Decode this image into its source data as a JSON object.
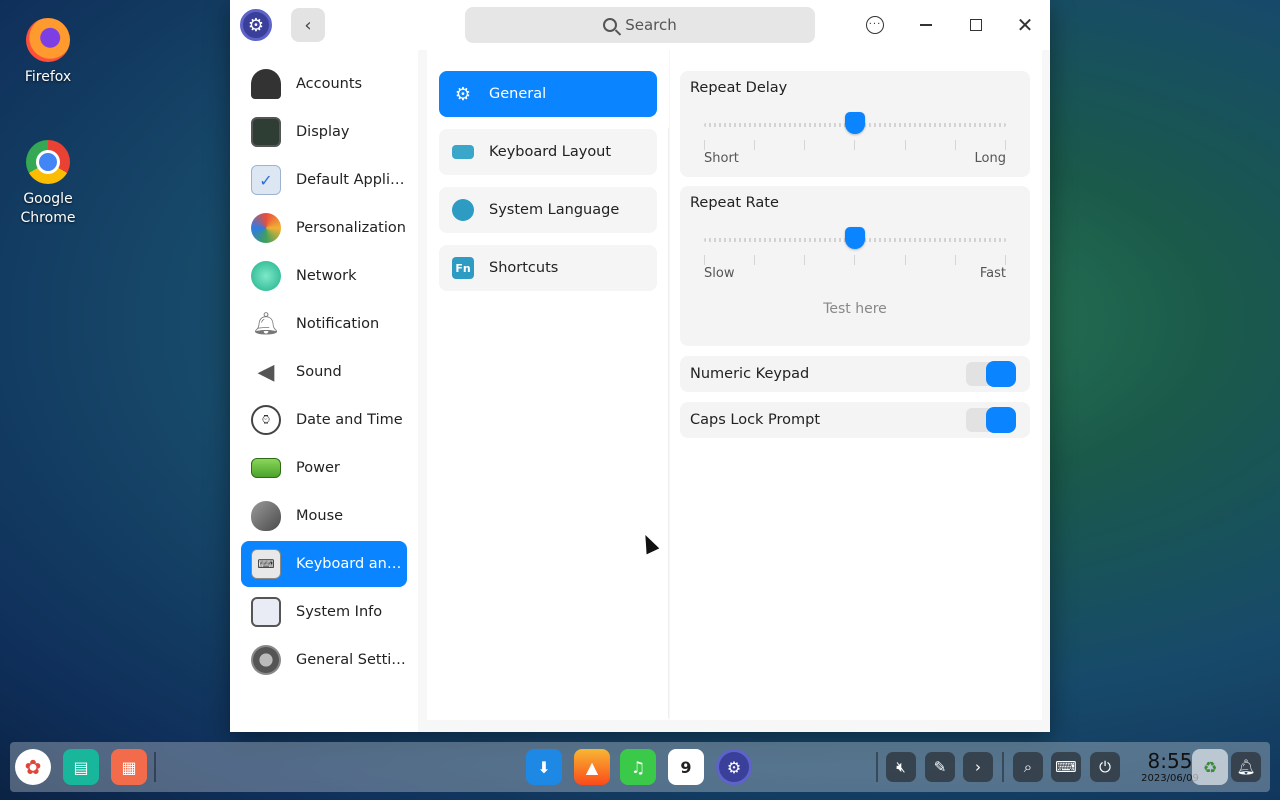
{
  "desktop": {
    "icons": [
      {
        "label": "Firefox",
        "icon": "firefox-icon"
      },
      {
        "label": "Google\nChrome",
        "icon": "chrome-icon"
      }
    ]
  },
  "window": {
    "search_placeholder": "Search",
    "left_nav": [
      {
        "label": "Accounts",
        "icon": "accounts-icon"
      },
      {
        "label": "Display",
        "icon": "display-icon"
      },
      {
        "label": "Default Applic...",
        "icon": "default-applications-icon"
      },
      {
        "label": "Personalization",
        "icon": "personalization-icon"
      },
      {
        "label": "Network",
        "icon": "network-icon"
      },
      {
        "label": "Notification",
        "icon": "notification-icon"
      },
      {
        "label": "Sound",
        "icon": "sound-icon"
      },
      {
        "label": "Date and Time",
        "icon": "clock-icon"
      },
      {
        "label": "Power",
        "icon": "battery-icon"
      },
      {
        "label": "Mouse",
        "icon": "mouse-icon"
      },
      {
        "label": "Keyboard and ...",
        "icon": "keyboard-icon",
        "active": true
      },
      {
        "label": "System Info",
        "icon": "system-info-icon"
      },
      {
        "label": "General Settin...",
        "icon": "general-settings-icon"
      }
    ],
    "sub_nav": [
      {
        "label": "General",
        "icon": "gear-icon",
        "active": true
      },
      {
        "label": "Keyboard Layout",
        "icon": "keyboard-layout-icon"
      },
      {
        "label": "System Language",
        "icon": "globe-icon"
      },
      {
        "label": "Shortcuts",
        "icon": "fn-icon",
        "glyph": "Fn"
      }
    ],
    "repeat_delay": {
      "title": "Repeat Delay",
      "min_label": "Short",
      "max_label": "Long",
      "value": 0.5
    },
    "repeat_rate": {
      "title": "Repeat Rate",
      "min_label": "Slow",
      "max_label": "Fast",
      "value": 0.5,
      "test_placeholder": "Test here"
    },
    "toggles": [
      {
        "label": "Numeric Keypad",
        "on": true
      },
      {
        "label": "Caps Lock Prompt",
        "on": true
      }
    ]
  },
  "taskbar": {
    "time": "8:55",
    "date": "2023/06/09",
    "calendar_day": "9"
  },
  "colors": {
    "accent": "#0a84ff"
  }
}
